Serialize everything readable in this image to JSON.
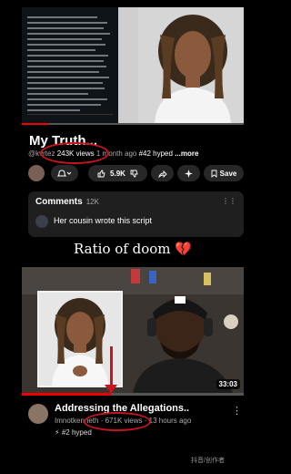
{
  "top_video": {
    "title": "My Truth...",
    "channel": "@kvrtez",
    "views": "243K views",
    "age": "1 month ago",
    "hype": "#42 hyped",
    "more": "...more"
  },
  "actions": {
    "likes": "5.9K",
    "save": "Save",
    "bell_icon": "bell-icon",
    "like_icon": "thumbs-up-icon",
    "dislike_icon": "thumbs-down-icon",
    "share_icon": "share-icon",
    "remix_icon": "sparkle-icon",
    "save_icon": "bookmark-icon"
  },
  "comments": {
    "label": "Comments",
    "count": "12K",
    "top_comment": "Her cousin wrote this script"
  },
  "caption": {
    "text": "Ratio of doom",
    "emoji": "💔"
  },
  "bottom_video": {
    "title": "Addressing the Allegations..",
    "channel": "Imnotkenneth",
    "views": "671K views",
    "age": "13 hours ago",
    "hype": "#2 hyped",
    "duration": "33:03"
  },
  "watermark": "抖音/创作者",
  "colors": {
    "annotation_red": "#c8141e",
    "progress_red": "#e00000",
    "card_bg": "#1f1f1f",
    "pill_bg": "#272727"
  }
}
